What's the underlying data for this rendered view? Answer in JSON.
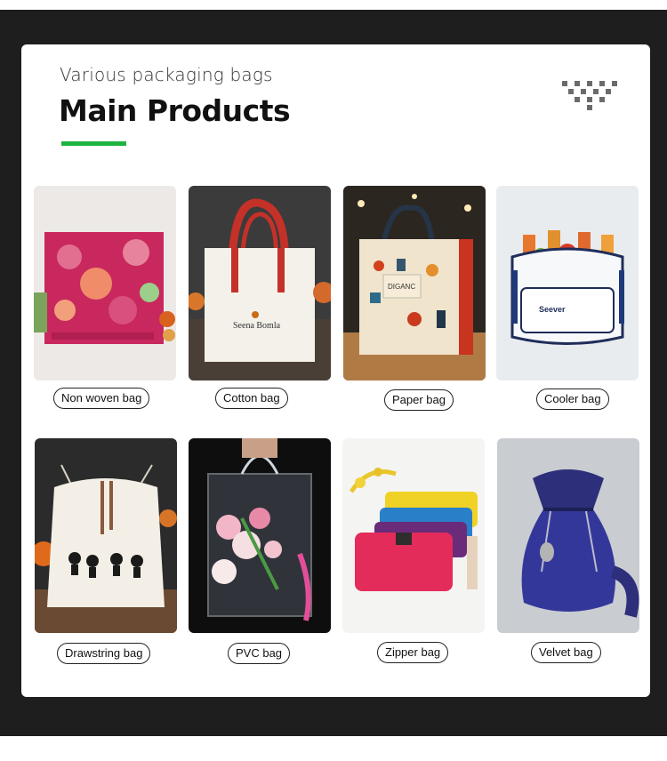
{
  "header": {
    "subtitle": "Various packaging bags",
    "title": "Main Products",
    "accent_color": "#1db33f"
  },
  "products": [
    {
      "label": "Non woven bag",
      "image": "non-woven-bag-image"
    },
    {
      "label": "Cotton bag",
      "image": "cotton-bag-image"
    },
    {
      "label": "Paper bag",
      "image": "paper-bag-image"
    },
    {
      "label": "Cooler bag",
      "image": "cooler-bag-image"
    },
    {
      "label": "Drawstring bag",
      "image": "drawstring-bag-image"
    },
    {
      "label": "PVC bag",
      "image": "pvc-bag-image"
    },
    {
      "label": "Zipper bag",
      "image": "zipper-bag-image"
    },
    {
      "label": "Velvet bag",
      "image": "velvet-bag-image"
    }
  ]
}
